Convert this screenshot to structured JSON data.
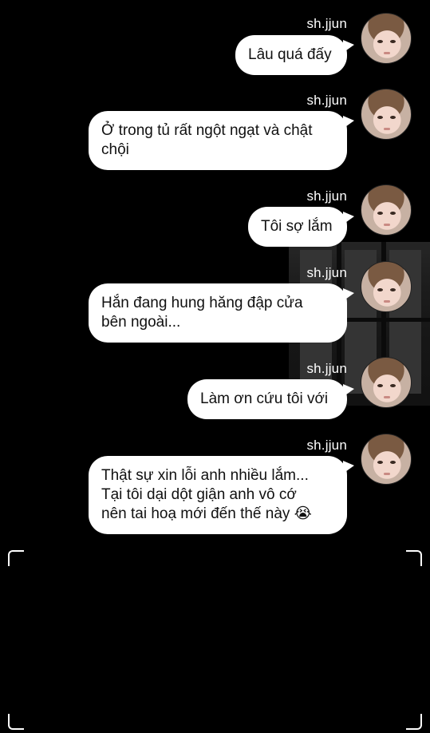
{
  "chat": {
    "messages": [
      {
        "sender": "sh.jjun",
        "text": "Lâu quá đấy"
      },
      {
        "sender": "sh.jjun",
        "text": "Ở trong tủ rất ngột ngạt và chật\nchội"
      },
      {
        "sender": "sh.jjun",
        "text": "Tôi sợ lắm"
      },
      {
        "sender": "sh.jjun",
        "text": "Hắn đang hung hăng đập cửa\nbên ngoài..."
      },
      {
        "sender": "sh.jjun",
        "text": "Làm ơn cứu tôi với"
      },
      {
        "sender": "sh.jjun",
        "text": "Thật sự xin lỗi anh nhiều lắm...\nTại tôi dại dột giận anh vô cớ\nnên tai hoạ mới đến thế này 😭"
      }
    ]
  },
  "colors": {
    "background": "#000000",
    "bubble": "#ffffff",
    "text": "#111111",
    "name": "#ffffff"
  },
  "icons": {
    "avatar": "profile-photo-icon",
    "viewfinder": "viewfinder-corner-icon"
  }
}
